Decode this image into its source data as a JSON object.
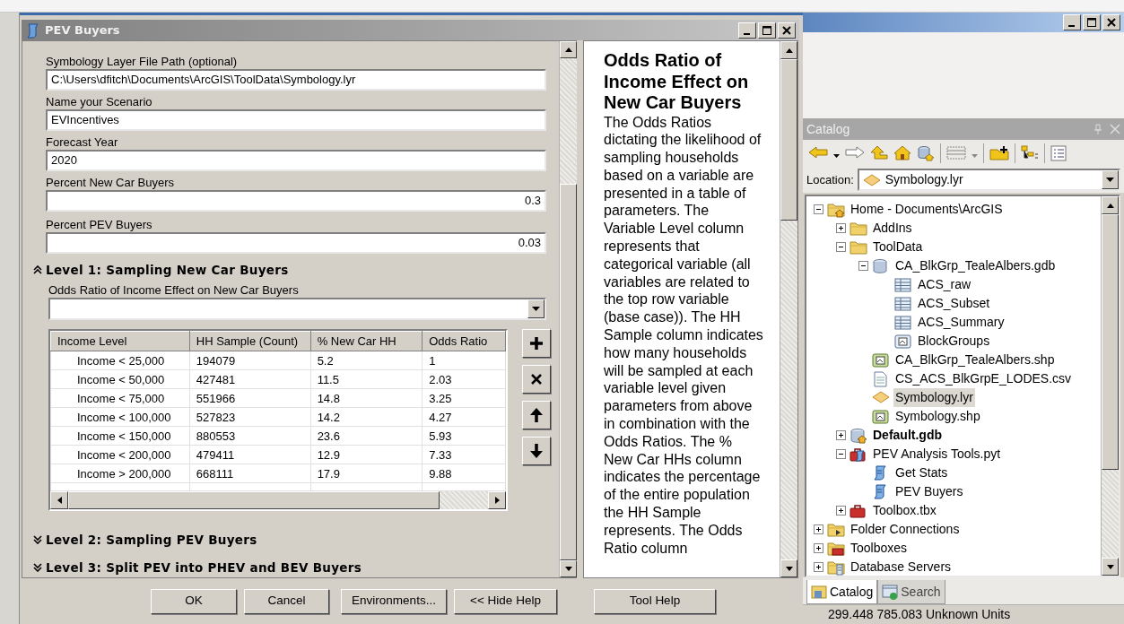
{
  "dialog": {
    "title": "PEV Buyers",
    "fields": [
      {
        "label": "Symbology Layer File Path (optional)",
        "value": "C:\\Users\\dfitch\\Documents\\ArcGIS\\ToolData\\Symbology.lyr",
        "kind": "text"
      },
      {
        "label": "Name your Scenario",
        "value": "EVIncentives",
        "kind": "text"
      },
      {
        "label": "Forecast Year",
        "value": "2020",
        "kind": "text"
      },
      {
        "label": "Percent New Car Buyers",
        "value": "0.3",
        "kind": "number"
      },
      {
        "label": "Percent PEV Buyers",
        "value": "0.03",
        "kind": "number"
      }
    ],
    "sections": [
      {
        "title": "Level 1: Sampling New Car Buyers",
        "expanded": true,
        "combo_label": "Odds Ratio of Income Effect on New Car Buyers",
        "table": {
          "columns": [
            "Income Level",
            "HH Sample (Count)",
            "% New Car HH",
            "Odds Ratio"
          ],
          "rows": [
            [
              "Income < 25,000",
              "194079",
              "5.2",
              "1"
            ],
            [
              "Income < 50,000",
              "427481",
              "11.5",
              "2.03"
            ],
            [
              "Income < 75,000",
              "551966",
              "14.8",
              "3.25"
            ],
            [
              "Income < 100,000",
              "527823",
              "14.2",
              "4.27"
            ],
            [
              "Income < 150,000",
              "880553",
              "23.6",
              "5.93"
            ],
            [
              "Income < 200,000",
              "479411",
              "12.9",
              "7.33"
            ],
            [
              "Income > 200,000",
              "668111",
              "17.9",
              "9.88"
            ]
          ]
        }
      },
      {
        "title": "Level 2: Sampling PEV Buyers",
        "expanded": false
      },
      {
        "title": "Level 3: Split PEV into PHEV and BEV Buyers",
        "expanded": false
      }
    ],
    "help": {
      "title": "Odds Ratio of Income Effect on New Car Buyers",
      "text": "The Odds Ratios dictating the likelihood of sampling households based on a variable are presented in a table of parameters. The Variable Level column represents that categorical variable (all variables are related to the top row variable (base case)). The HH Sample column indicates how many households will be sampled at each variable level given parameters from above in combination with the Odds Ratios. The % New Car HHs column indicates the percentage of the entire population the HH Sample represents. The Odds Ratio column",
      "button": "Tool Help"
    },
    "buttons": [
      "OK",
      "Cancel",
      "Environments...",
      "<< Hide Help"
    ]
  },
  "catalog": {
    "title": "Catalog",
    "location": {
      "label": "Location:",
      "value": "Symbology.lyr"
    },
    "tree": [
      {
        "label": "Home - Documents\\ArcGIS",
        "kind": "home-folder",
        "expanded": true,
        "selected": false,
        "children": [
          {
            "label": "AddIns",
            "kind": "folder",
            "expanded": false,
            "selected": false
          },
          {
            "label": "ToolData",
            "kind": "folder",
            "expanded": true,
            "selected": false,
            "children": [
              {
                "label": "CA_BlkGrp_TealeAlbers.gdb",
                "kind": "geodatabase",
                "expanded": true,
                "selected": false,
                "children": [
                  {
                    "label": "ACS_raw",
                    "kind": "table",
                    "selected": false
                  },
                  {
                    "label": "ACS_Subset",
                    "kind": "table",
                    "selected": false
                  },
                  {
                    "label": "ACS_Summary",
                    "kind": "table",
                    "selected": false
                  },
                  {
                    "label": "BlockGroups",
                    "kind": "feature-class",
                    "selected": false
                  }
                ]
              },
              {
                "label": "CA_BlkGrp_TealeAlbers.shp",
                "kind": "shapefile",
                "selected": false
              },
              {
                "label": "CS_ACS_BlkGrpE_LODES.csv",
                "kind": "text-file",
                "selected": false
              },
              {
                "label": "Symbology.lyr",
                "kind": "layer",
                "selected": true
              },
              {
                "label": "Symbology.shp",
                "kind": "shapefile",
                "selected": false
              }
            ]
          },
          {
            "label": "Default.gdb",
            "kind": "home-geodatabase",
            "expanded": false,
            "selected": false,
            "bold": true
          },
          {
            "label": "PEV Analysis Tools.pyt",
            "kind": "python-toolbox",
            "expanded": true,
            "selected": false,
            "children": [
              {
                "label": "Get Stats",
                "kind": "script",
                "selected": false
              },
              {
                "label": "PEV Buyers",
                "kind": "script",
                "selected": false
              }
            ]
          },
          {
            "label": "Toolbox.tbx",
            "kind": "toolbox",
            "expanded": false,
            "selected": false
          }
        ]
      },
      {
        "label": "Folder Connections",
        "kind": "folder-connection",
        "expanded": false,
        "selected": false
      },
      {
        "label": "Toolboxes",
        "kind": "toolboxes",
        "expanded": false,
        "selected": false
      },
      {
        "label": "Database Servers",
        "kind": "database-servers",
        "expanded": false,
        "selected": false
      }
    ],
    "tabs": [
      {
        "label": "Catalog",
        "selected": true
      },
      {
        "label": "Search",
        "selected": false
      }
    ],
    "status": "299.448  785.083 Unknown Units"
  }
}
